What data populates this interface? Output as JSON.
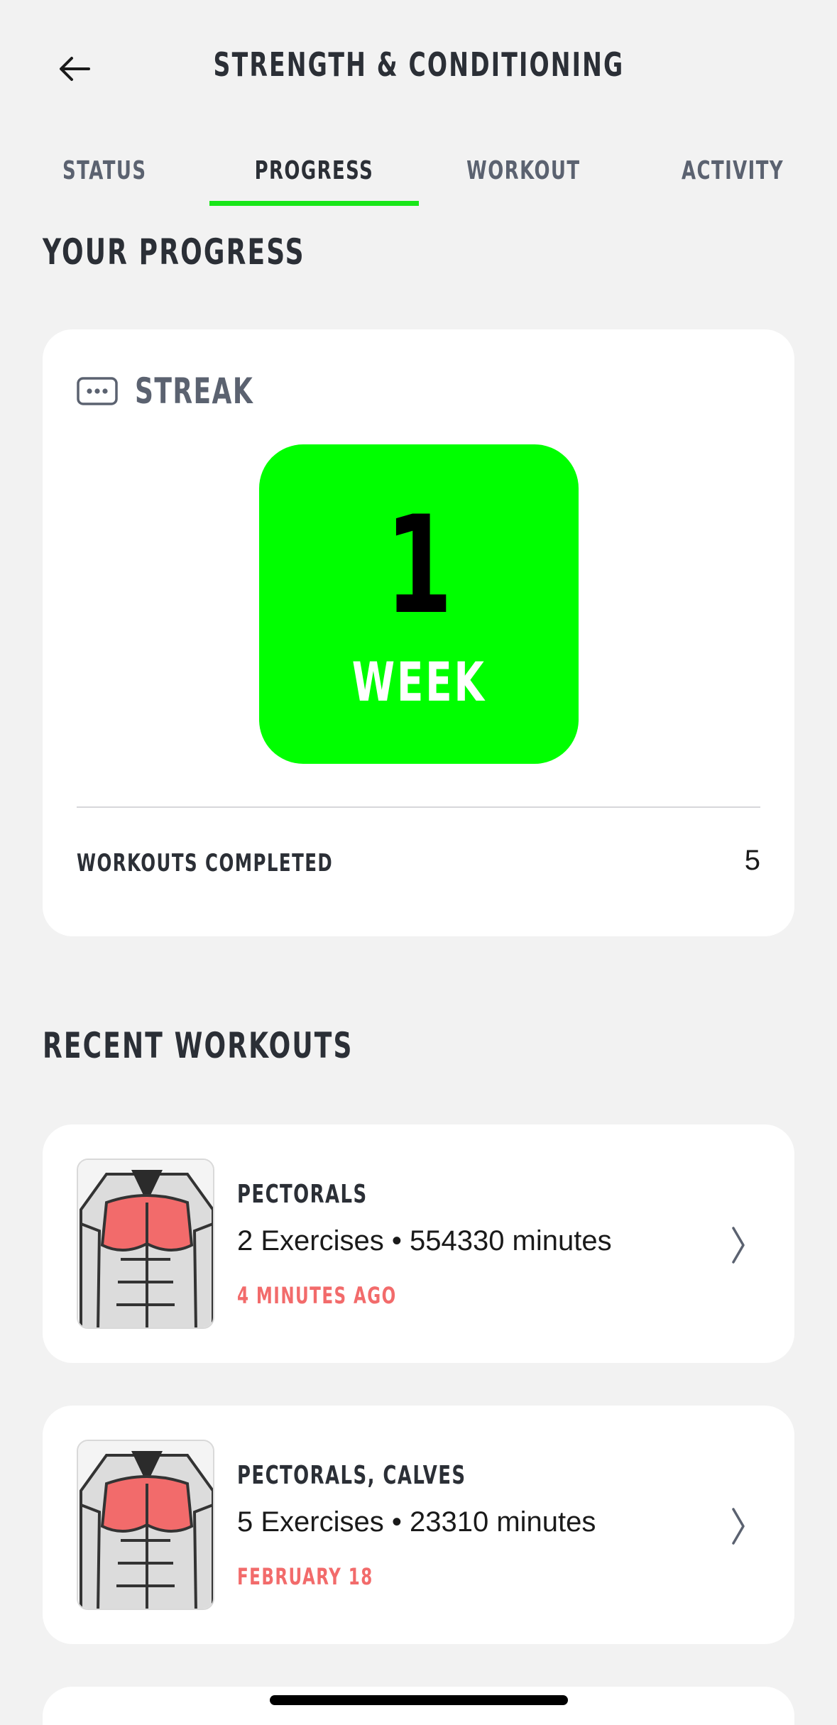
{
  "header": {
    "title": "STRENGTH & CONDITIONING",
    "back_icon": "arrow-left-icon"
  },
  "tabs": [
    {
      "label": "STATUS",
      "active": false
    },
    {
      "label": "PROGRESS",
      "active": true
    },
    {
      "label": "WORKOUT",
      "active": false
    },
    {
      "label": "ACTIVITY",
      "active": false
    }
  ],
  "progress": {
    "heading": "YOUR PROGRESS",
    "streak": {
      "label": "STREAK",
      "icon": "dots-badge-icon",
      "value": "1",
      "unit": "WEEK",
      "box_color": "#00ff00"
    },
    "workouts_completed": {
      "label": "WORKOUTS COMPLETED",
      "value": "5"
    }
  },
  "recent": {
    "heading": "RECENT WORKOUTS",
    "items": [
      {
        "title": "PECTORALS",
        "detail": "2 Exercises • 554330 minutes",
        "time": "4 MINUTES AGO",
        "thumbnail_icon": "chest-muscle-diagram-icon"
      },
      {
        "title": "PECTORALS, CALVES",
        "detail": "5 Exercises • 23310 minutes",
        "time": "FEBRUARY 18",
        "thumbnail_icon": "chest-muscle-diagram-icon"
      }
    ]
  },
  "colors": {
    "accent_green": "#19e619",
    "time_red": "#f26b6b",
    "background": "#f2f2f2"
  }
}
